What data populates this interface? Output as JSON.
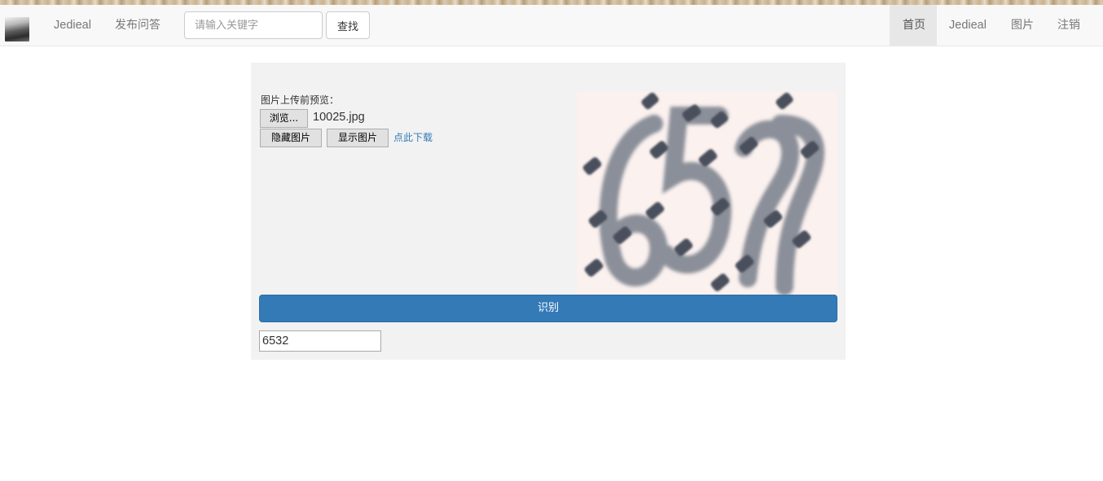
{
  "navbar": {
    "links_left": [
      "Jedieal",
      "发布问答"
    ],
    "search_placeholder": "请输入关键字",
    "search_button": "查找",
    "links_right": [
      "首页",
      "Jedieal",
      "图片",
      "注销"
    ],
    "active_link": "首页"
  },
  "upload": {
    "preview_label": "图片上传前预览：",
    "browse_button": "浏览...",
    "file_name": "10025.jpg",
    "hide_button": "隐藏图片",
    "show_button": "显示图片",
    "download_link": "点此下载"
  },
  "captcha": {
    "description": "captcha-image",
    "digits": "6532"
  },
  "recognize_button": "识别",
  "result_value": "6532",
  "colors": {
    "primary": "#337ab7",
    "navbar_bg": "#f8f8f8",
    "panel_bg": "#f2f2f2",
    "link": "#337ab7"
  }
}
